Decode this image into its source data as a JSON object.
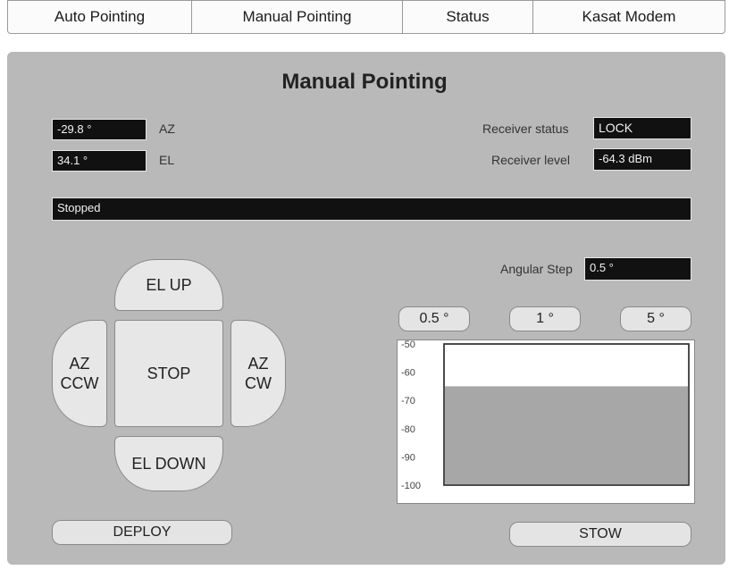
{
  "tabs": [
    {
      "label": "Auto Pointing"
    },
    {
      "label": "Manual Pointing"
    },
    {
      "label": "Status"
    },
    {
      "label": "Kasat Modem"
    }
  ],
  "panel": {
    "title": "Manual Pointing",
    "az_value": "-29.8 °",
    "az_label": "AZ",
    "el_value": "34.1 °",
    "el_label": "EL",
    "receiver_status_label": "Receiver status",
    "receiver_status_value": "LOCK",
    "receiver_level_label": "Receiver level",
    "receiver_level_value": "-64.3 dBm",
    "motion_status": "Stopped",
    "angular_step_label": "Angular Step",
    "angular_step_value": "0.5 °"
  },
  "pad": {
    "el_up": "EL UP",
    "el_down": "EL DOWN",
    "stop": "STOP",
    "az_ccw_1": "AZ",
    "az_ccw_2": "CCW",
    "az_cw_1": "AZ",
    "az_cw_2": "CW"
  },
  "step_buttons": [
    "0.5 °",
    "1 °",
    "5 °"
  ],
  "actions": {
    "deploy": "DEPLOY",
    "stow": "STOW"
  },
  "chart_data": {
    "type": "area",
    "ylim": [
      -100,
      -50
    ],
    "y_ticks": [
      "-50",
      "-60",
      "-70",
      "-80",
      "-90",
      "-100"
    ],
    "series": [
      {
        "values": [
          -65,
          -65,
          -65,
          -65,
          -65,
          -65,
          -65,
          -65,
          -65,
          -65
        ]
      }
    ],
    "colors": {
      "fill": "#a7a7a7",
      "background": "#ffffff"
    }
  }
}
